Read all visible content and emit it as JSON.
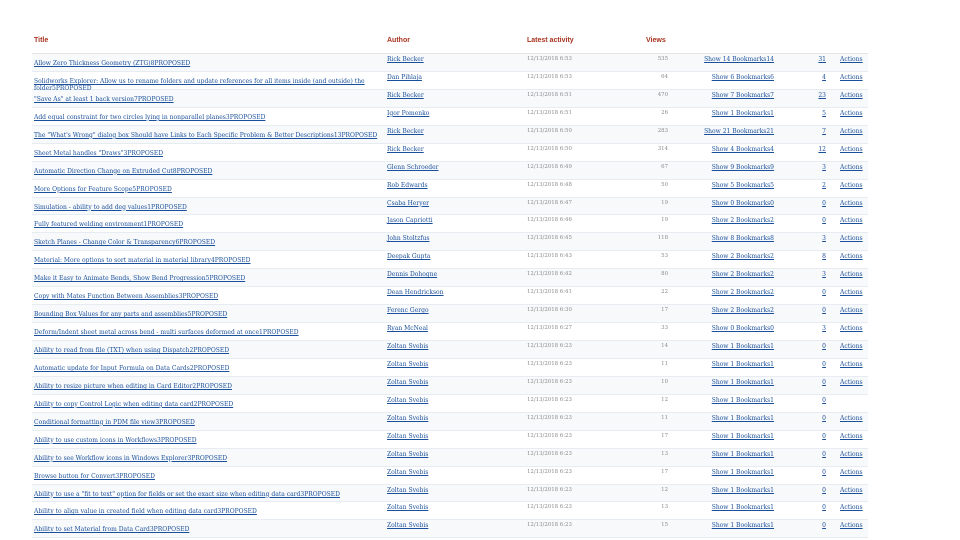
{
  "headers": {
    "title": "Title",
    "author": "Author",
    "activity": "Latest activity",
    "views": "Views"
  },
  "rows": [
    {
      "title": "Allow Zero Thickness Geometry (ZTG)8PROPOSED",
      "author": "Rick Becker",
      "date": "12/13/2018 6:53",
      "views": "535",
      "show": "Show 14 Bookmarks14",
      "count": "31",
      "actions": "Actions"
    },
    {
      "title": "Solidworks Explorer: Allow us to rename folders and update references for all items inside (and outside) the folder5PROPOSED",
      "author": "Dan Pihlaja",
      "date": "12/13/2018 6:53",
      "views": "64",
      "show": "Show 6 Bookmarks6",
      "count": "4",
      "actions": "Actions"
    },
    {
      "title": "\"Save As\" at least 1 back version7PROPOSED",
      "author": "Rick Becker",
      "date": "12/13/2018 6:51",
      "views": "470",
      "show": "Show 7 Bookmarks7",
      "count": "23",
      "actions": "Actions"
    },
    {
      "title": "Add equal constraint for two circles lying in nonparallel planes3PROPOSED",
      "author": "Igor Pomenko",
      "date": "12/13/2018 6:51",
      "views": "26",
      "show": "Show 1 Bookmarks1",
      "count": "5",
      "actions": "Actions"
    },
    {
      "title": "The \"What's Wrong\" dialog box Should have Links to Each Specific Problem & Better Descriptions13PROPOSED",
      "author": "Rick Becker",
      "date": "12/13/2018 6:50",
      "views": "283",
      "show": "Show 21 Bookmarks21",
      "count": "7",
      "actions": "Actions"
    },
    {
      "title": "Sheet Metal handles \"Draws\"3PROPOSED",
      "author": "Rick Becker",
      "date": "12/13/2018 6:50",
      "views": "314",
      "show": "Show 4 Bookmarks4",
      "count": "12",
      "actions": "Actions"
    },
    {
      "title": "Automatic Direction Change on Extruded Cut8PROPOSED",
      "author": "Glenn Schroeder",
      "date": "12/13/2018 6:49",
      "views": "67",
      "show": "Show 9 Bookmarks9",
      "count": "3",
      "actions": "Actions"
    },
    {
      "title": "More Options for Feature Scope5PROPOSED",
      "author": "Rob Edwards",
      "date": "12/13/2018 6:48",
      "views": "50",
      "show": "Show 5 Bookmarks5",
      "count": "2",
      "actions": "Actions"
    },
    {
      "title": "Simulation - ability to add deg values1PROPOSED",
      "author": "Csaba Heryer",
      "date": "12/13/2018 6:47",
      "views": "19",
      "show": "Show 0 Bookmarks0",
      "count": "0",
      "actions": "Actions"
    },
    {
      "title": "Fully featured welding environment1PROPOSED",
      "author": "Jason Capriotti",
      "date": "12/13/2018 6:46",
      "views": "19",
      "show": "Show 2 Bookmarks2",
      "count": "0",
      "actions": "Actions"
    },
    {
      "title": "Sketch Planes - Change Color & Transparency6PROPOSED",
      "author": "John Stoltzfus",
      "date": "12/13/2018 6:45",
      "views": "118",
      "show": "Show 8 Bookmarks8",
      "count": "3",
      "actions": "Actions"
    },
    {
      "title": "Material: More options to sort material in material library4PROPOSED",
      "author": "Deepak Gupta",
      "date": "12/13/2018 6:43",
      "views": "53",
      "show": "Show 2 Bookmarks2",
      "count": "8",
      "actions": "Actions"
    },
    {
      "title": "Make it Easy to Animate Bends, Show Bend Progression5PROPOSED",
      "author": "Dennis Dohogne",
      "date": "12/13/2018 6:42",
      "views": "80",
      "show": "Show 2 Bookmarks2",
      "count": "3",
      "actions": "Actions"
    },
    {
      "title": "Copy with Mates Function Between Assemblies3PROPOSED",
      "author": "Dean Hendrickson",
      "date": "12/13/2018 6:41",
      "views": "22",
      "show": "Show 2 Bookmarks2",
      "count": "0",
      "actions": "Actions"
    },
    {
      "title": "Bounding Box Values for any parts and assemblies5PROPOSED",
      "author": "Ferenc Gergo",
      "date": "12/13/2018 6:30",
      "views": "17",
      "show": "Show 2 Bookmarks2",
      "count": "0",
      "actions": "Actions"
    },
    {
      "title": "Deform/Indent sheet metal across bend - multi surfaces deformed at once1PROPOSED",
      "author": "Ryan McNeal",
      "date": "12/13/2018 6:27",
      "views": "33",
      "show": "Show 0 Bookmarks0",
      "count": "3",
      "actions": "Actions"
    },
    {
      "title": "Ability to read from file (TXT) when using Dispatch2PROPOSED",
      "author": "Zoltan Svebis",
      "date": "12/13/2018 6:23",
      "views": "14",
      "show": "Show 1 Bookmarks1",
      "count": "0",
      "actions": "Actions"
    },
    {
      "title": "Automatic update for Input Formula on Data Cards2PROPOSED",
      "author": "Zoltan Svebis",
      "date": "12/13/2018 6:23",
      "views": "11",
      "show": "Show 1 Bookmarks1",
      "count": "0",
      "actions": "Actions"
    },
    {
      "title": "Ability to resize picture when editing in Card Editor2PROPOSED",
      "author": "Zoltan Svebis",
      "date": "12/13/2018 6:23",
      "views": "10",
      "show": "Show 1 Bookmarks1",
      "count": "0",
      "actions": "Actions"
    },
    {
      "title": "Ability to copy Control Logic when editing data card2PROPOSED",
      "author": "Zoltan Svebis",
      "date": "12/13/2018 6:23",
      "views": "12",
      "show": "Show 1 Bookmarks1",
      "count": "0",
      "actions": ""
    },
    {
      "title": "Conditional formatting in PDM file view3PROPOSED",
      "author": "Zoltan Svebis",
      "date": "12/13/2018 6:23",
      "views": "11",
      "show": "Show 1 Bookmarks1",
      "count": "0",
      "actions": "Actions"
    },
    {
      "title": "Ability to use custom icons in Workflows3PROPOSED",
      "author": "Zoltan Svebis",
      "date": "12/13/2018 6:23",
      "views": "17",
      "show": "Show 1 Bookmarks1",
      "count": "0",
      "actions": "Actions"
    },
    {
      "title": "Ability to see Workflow icons in Windows Explorer3PROPOSED",
      "author": "Zoltan Svebis",
      "date": "12/13/2018 6:23",
      "views": "13",
      "show": "Show 1 Bookmarks1",
      "count": "0",
      "actions": "Actions"
    },
    {
      "title": "Browse button for Convert3PROPOSED",
      "author": "Zoltan Svebis",
      "date": "12/13/2018 6:23",
      "views": "17",
      "show": "Show 1 Bookmarks1",
      "count": "0",
      "actions": "Actions"
    },
    {
      "title": "Ability to use a \"fit to text\" option for fields or set the exact size when editing data card3PROPOSED",
      "author": "Zoltan Svebis",
      "date": "12/13/2018 6:23",
      "views": "12",
      "show": "Show 1 Bookmarks1",
      "count": "0",
      "actions": "Actions"
    },
    {
      "title": "Ability to align value in created field when editing data card3PROPOSED",
      "author": "Zoltan Svebis",
      "date": "12/13/2018 6:23",
      "views": "13",
      "show": "Show 1 Bookmarks1",
      "count": "0",
      "actions": "Actions"
    },
    {
      "title": "Ability to set Material from Data Card3PROPOSED",
      "author": "Zoltan Svebis",
      "date": "12/13/2018 6:23",
      "views": "15",
      "show": "Show 1 Bookmarks1",
      "count": "0",
      "actions": "Actions"
    }
  ]
}
